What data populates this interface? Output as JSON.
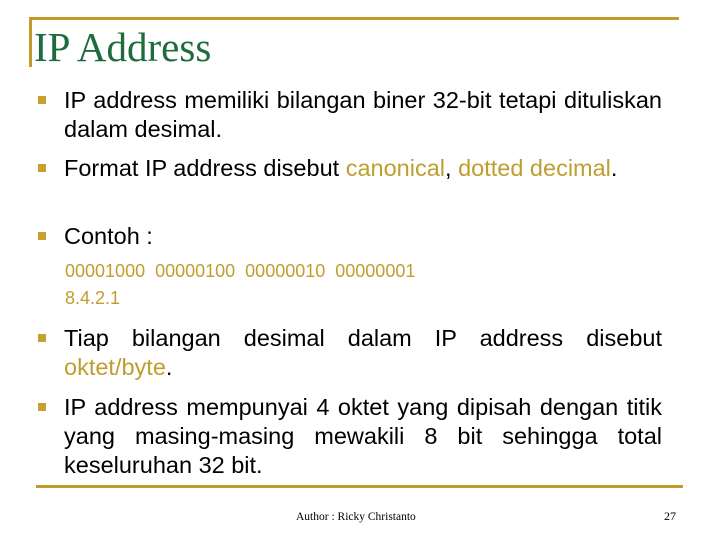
{
  "slide": {
    "title": "IP Address",
    "colors": {
      "title": "#1E6B3C",
      "accent": "#C19A2B",
      "highlight": "#BF9E2F",
      "body": "#000000"
    },
    "bullet_icon": "square-bullet",
    "bullets": [
      {
        "segments": [
          {
            "text": "IP address memiliki bilangan biner 32-bit tetapi dituliskan dalam desimal."
          }
        ]
      },
      {
        "segments": [
          {
            "text": "Format IP address disebut "
          },
          {
            "text": "canonical",
            "highlight": true
          },
          {
            "text": ", "
          },
          {
            "text": "dotted decimal",
            "highlight": true
          },
          {
            "text": "."
          }
        ]
      },
      {
        "segments": [
          {
            "text": "Contoh :"
          }
        ]
      },
      {
        "segments": [
          {
            "text": "Tiap bilangan desimal dalam IP address disebut "
          },
          {
            "text": "oktet/byte",
            "highlight": true
          },
          {
            "text": "."
          }
        ]
      },
      {
        "segments": [
          {
            "text": "IP address mempunyai 4 oktet yang dipisah dengan titik yang masing-masing mewakili 8 bit sehingga total keseluruhan 32 bit."
          }
        ]
      }
    ],
    "example": {
      "binary": "00001000  00000100  00000010  00000001",
      "decimal": "8.4.2.1"
    },
    "footer": {
      "author": "Author : Ricky Christanto",
      "page_number": "27"
    }
  }
}
